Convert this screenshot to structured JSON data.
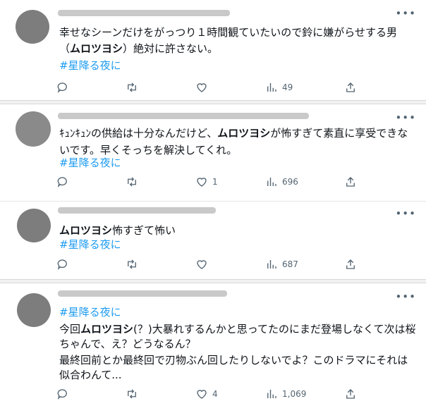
{
  "tweets": [
    {
      "lines": [
        "幸せなシーンだけをがっつり１時間観ていたいので鈴に嫌がらせする男",
        [
          "（",
          "ムロツヨシ",
          "）絶対に許さない。"
        ]
      ],
      "hashtag": "#星降る夜に",
      "reply": "",
      "retweet": "",
      "like": "",
      "views": "49"
    },
    {
      "lines": [
        [
          "ｷｭﾝｷｭﾝの供給は十分なんだけど、",
          "ムロツヨシ",
          "が怖すぎて素直に享受できな"
        ],
        "いです。早くそっちを解決してくれ。"
      ],
      "hashtag": "#星降る夜に",
      "reply": "",
      "retweet": "",
      "like": "1",
      "views": "696"
    },
    {
      "lines": [
        [
          "",
          "ムロツヨシ",
          "怖すぎて怖い"
        ]
      ],
      "hashtag": "#星降る夜に",
      "reply": "",
      "retweet": "",
      "like": "",
      "views": "687"
    },
    {
      "hashtag": "#星降る夜に",
      "lines": [
        [
          "今回",
          "ムロツヨシ",
          "(？)大暴れするんかと思ってたのにまだ登場しなくて次は桜"
        ],
        "ちゃんで、え？どうなるん？",
        "最終回前とか最終回で刃物ぶん回したりしないでよ？このドラマにそれは",
        "似合わんて..."
      ],
      "reply": "",
      "retweet": "",
      "like": "4",
      "views": "1,069"
    }
  ],
  "icons": {
    "more": "more-icon",
    "reply": "reply-icon",
    "retweet": "retweet-icon",
    "like": "like-icon",
    "views": "views-icon",
    "share": "share-icon"
  },
  "colors": {
    "hashtag": "#1d9bf0",
    "icon": "#536471",
    "text": "#0f1419"
  }
}
